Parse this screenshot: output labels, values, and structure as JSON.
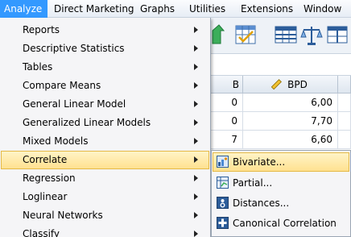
{
  "menubar": {
    "items": [
      {
        "label": "Analyze",
        "active": true
      },
      {
        "label": "Direct Marketing"
      },
      {
        "label": "Graphs"
      },
      {
        "label": "Utilities"
      },
      {
        "label": "Extensions"
      },
      {
        "label": "Window"
      }
    ]
  },
  "analyze_menu": {
    "items": [
      {
        "label": "Reports",
        "submenu": true
      },
      {
        "label": "Descriptive Statistics",
        "submenu": true
      },
      {
        "label": "Tables",
        "submenu": true
      },
      {
        "label": "Compare Means",
        "submenu": true
      },
      {
        "label": "General Linear Model",
        "submenu": true
      },
      {
        "label": "Generalized Linear Models",
        "submenu": true
      },
      {
        "label": "Mixed Models",
        "submenu": true
      },
      {
        "label": "Correlate",
        "submenu": true,
        "active": true
      },
      {
        "label": "Regression",
        "submenu": true
      },
      {
        "label": "Loglinear",
        "submenu": true
      },
      {
        "label": "Neural Networks",
        "submenu": true
      },
      {
        "label": "Classify",
        "submenu": true
      }
    ]
  },
  "correlate_submenu": {
    "items": [
      {
        "label": "Bivariate...",
        "icon": "bivariate-icon",
        "active": true
      },
      {
        "label": "Partial...",
        "icon": "partial-icon"
      },
      {
        "label": "Distances...",
        "icon": "distances-icon"
      },
      {
        "label": "Canonical Correlation",
        "icon": "canonical-correlation-icon"
      }
    ]
  },
  "data_view": {
    "columns": [
      "B",
      "BPD"
    ],
    "bpd_column_icon": "ruler-icon",
    "rows": [
      {
        "b": "0",
        "bpd": "6,00"
      },
      {
        "b": "0",
        "bpd": "7,70"
      },
      {
        "b": "7",
        "bpd": "6,60"
      }
    ]
  },
  "colors": {
    "menu_active": "#3399ff",
    "item_highlight": "#ffe190",
    "highlight_border": "#e5b945"
  }
}
